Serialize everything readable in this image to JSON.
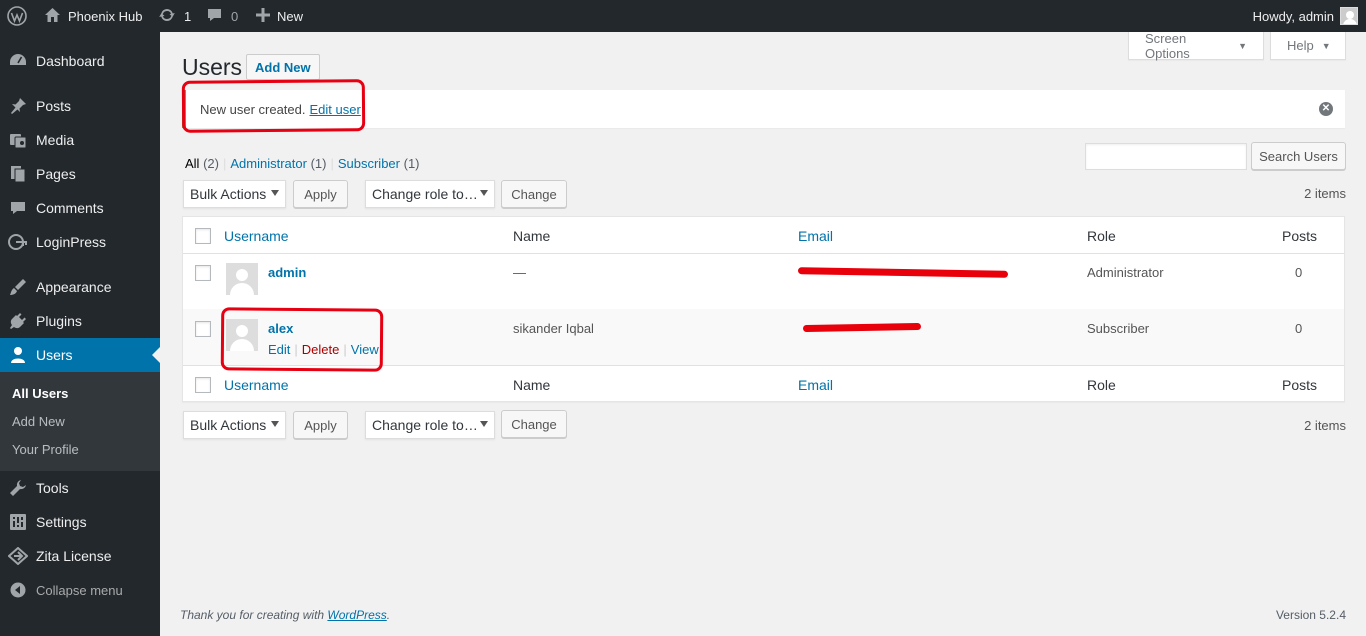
{
  "adminbar": {
    "site_name": "Phoenix Hub",
    "updates_count": "1",
    "comments_count": "0",
    "new_label": "New",
    "howdy": "Howdy, admin"
  },
  "sidebar": {
    "items": [
      {
        "label": "Dashboard",
        "icon": "dashboard-icon"
      },
      {
        "label": "Posts",
        "icon": "pushpin-icon"
      },
      {
        "label": "Media",
        "icon": "media-icon"
      },
      {
        "label": "Pages",
        "icon": "pages-icon"
      },
      {
        "label": "Comments",
        "icon": "comments-icon"
      },
      {
        "label": "LoginPress",
        "icon": "loginpress-icon"
      },
      {
        "label": "Appearance",
        "icon": "appearance-icon"
      },
      {
        "label": "Plugins",
        "icon": "plugins-icon"
      },
      {
        "label": "Users",
        "icon": "users-icon"
      },
      {
        "label": "Tools",
        "icon": "tools-icon"
      },
      {
        "label": "Settings",
        "icon": "settings-icon"
      },
      {
        "label": "Zita License",
        "icon": "zita-icon"
      }
    ],
    "submenu": [
      "All Users",
      "Add New",
      "Your Profile"
    ],
    "collapse_label": "Collapse menu"
  },
  "screen_options": "Screen Options",
  "help": "Help",
  "page": {
    "title": "Users",
    "add_new": "Add New"
  },
  "notice": {
    "message": "New user created.",
    "link": "Edit user"
  },
  "filters": {
    "all": "All",
    "all_count": "(2)",
    "administrator": "Administrator",
    "administrator_count": "(1)",
    "subscriber": "Subscriber",
    "subscriber_count": "(1)",
    "separator": "|"
  },
  "search": {
    "button": "Search Users",
    "value": ""
  },
  "tablenav": {
    "bulk_actions": "Bulk Actions",
    "apply": "Apply",
    "change_role": "Change role to…",
    "change": "Change",
    "items_count": "2 items"
  },
  "table": {
    "columns": [
      "Username",
      "Name",
      "Email",
      "Role",
      "Posts"
    ],
    "rows": [
      {
        "username": "admin",
        "name": "—",
        "role": "Administrator",
        "posts": "0"
      },
      {
        "username": "alex",
        "name": "sikander Iqbal",
        "role": "Subscriber",
        "posts": "0",
        "actions": [
          "Edit",
          "Delete",
          "View"
        ]
      }
    ]
  },
  "footer": {
    "thanks_prefix": "Thank you for creating with",
    "thanks_link": "WordPress",
    "thanks_suffix": ".",
    "version": "Version 5.2.4"
  },
  "colors": {
    "adminbar_bg": "#23282d",
    "accent": "#0073aa",
    "annotation": "#e60012"
  }
}
